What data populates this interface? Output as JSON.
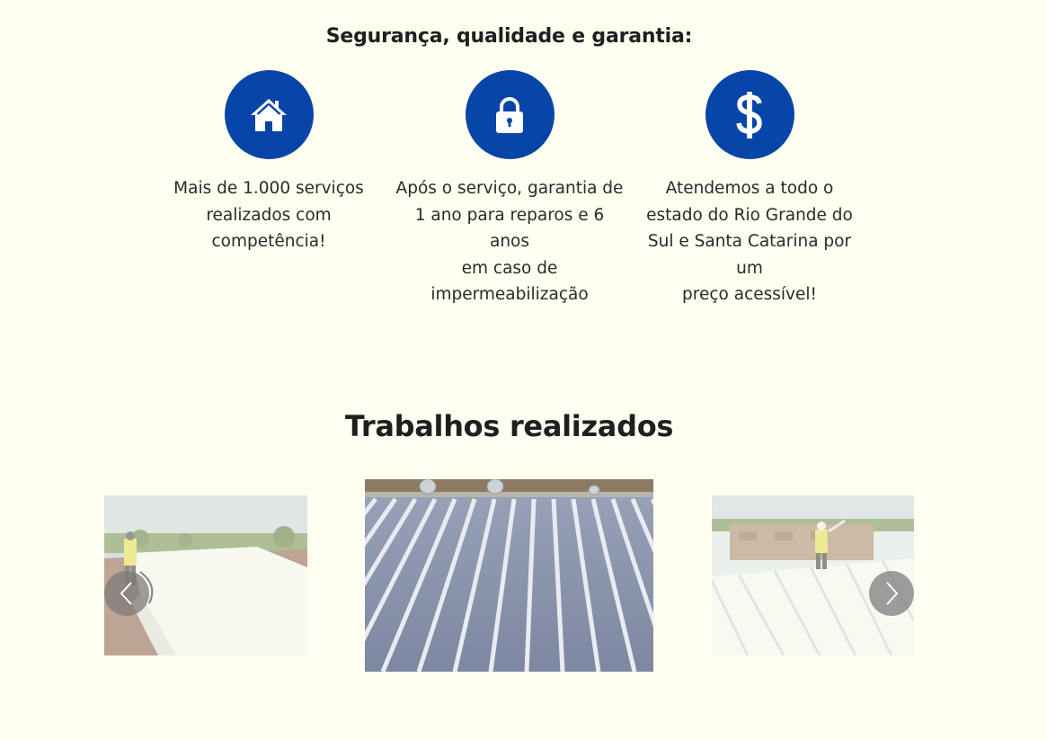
{
  "features": {
    "heading": "Segurança, qualidade e garantia:",
    "items": [
      {
        "icon": "home-icon",
        "text_lines": [
          "Mais de 1.000 serviços",
          "realizados com",
          "competência!"
        ]
      },
      {
        "icon": "lock-icon",
        "text_lines": [
          "Após o serviço, garantia de",
          "1 ano para reparos e 6 anos",
          "em caso de",
          "impermeabilização"
        ]
      },
      {
        "icon": "dollar-icon",
        "text_lines": [
          "Atendemos a todo o",
          "estado do Rio Grande do",
          "Sul e Santa Catarina por um",
          "preço acessível!"
        ]
      }
    ],
    "icon_color": "#0845a9"
  },
  "works": {
    "heading": "Trabalhos realizados",
    "slides": [
      {
        "subject": "worker-spraying-white-roof",
        "state": "inactive"
      },
      {
        "subject": "corrugated-metal-roof-with-ventilators",
        "state": "active"
      },
      {
        "subject": "worker-on-white-corrugated-roof",
        "state": "inactive"
      }
    ],
    "prev_icon": "chevron-left-icon",
    "next_icon": "chevron-right-icon"
  },
  "colors": {
    "background": "#fefff0",
    "accent": "#0845a9",
    "text": "#1f1f1f"
  }
}
